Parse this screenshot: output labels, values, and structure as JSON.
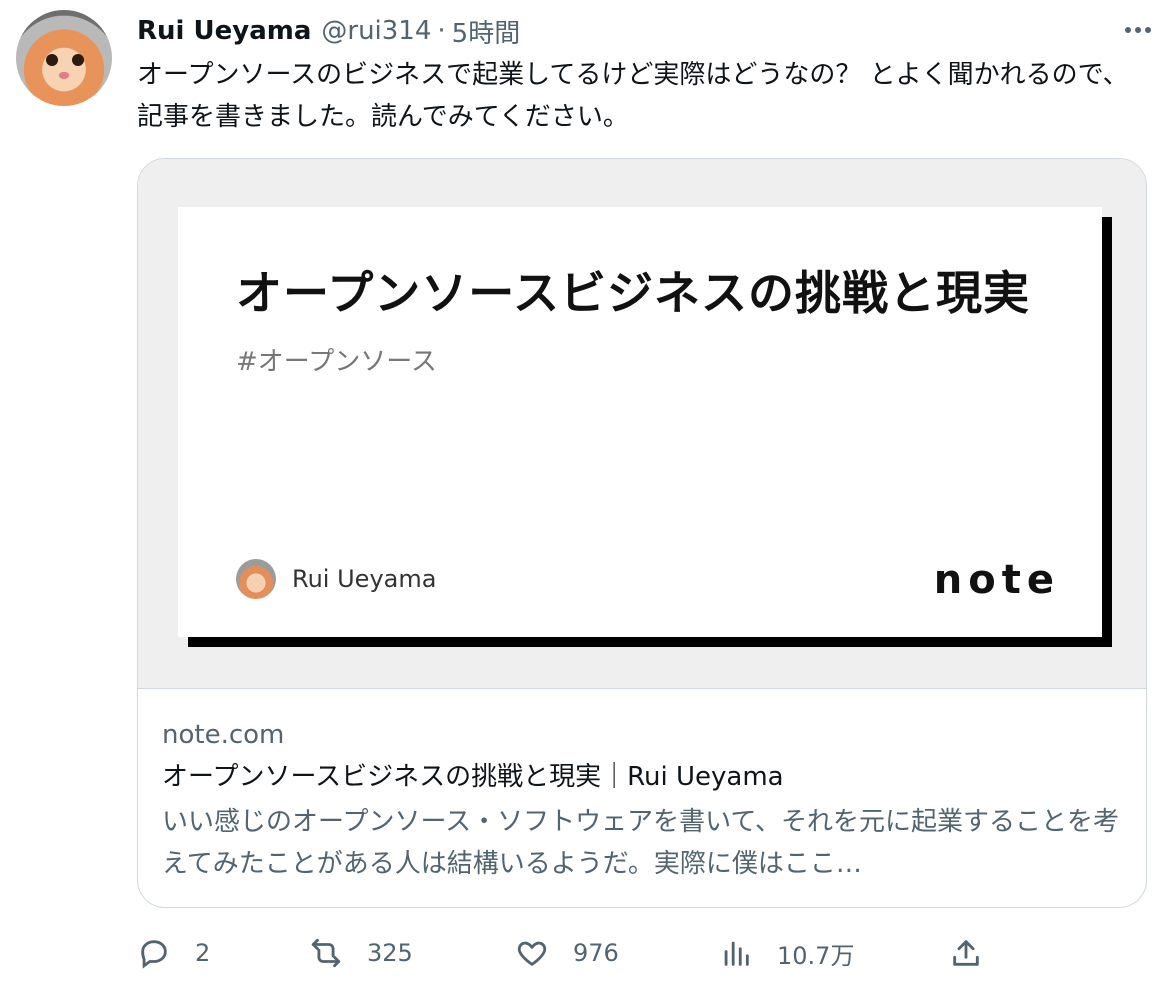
{
  "author": {
    "name": "Rui Ueyama",
    "handle": "@rui314",
    "separator": "·",
    "time": "5時間"
  },
  "tweet": {
    "text": "オープンソースのビジネスで起業してるけど実際はどうなの？ とよく聞かれるので、記事を書きました。読んでみてください。"
  },
  "card": {
    "image": {
      "title": "オープンソースビジネスの挑戦と現実",
      "tag": "#オープンソース",
      "author": "Rui Ueyama",
      "logo": "note"
    },
    "domain": "note.com",
    "title": "オープンソースビジネスの挑戦と現実｜Rui Ueyama",
    "description": "いい感じのオープンソース・ソフトウェアを書いて、それを元に起業することを考えてみたことがある人は結構いるようだ。実際に僕はここ…"
  },
  "actions": {
    "replies": "2",
    "retweets": "325",
    "likes": "976",
    "views": "10.7万"
  },
  "icons": [
    "more-icon",
    "reply-icon",
    "retweet-icon",
    "like-icon",
    "views-icon",
    "share-icon"
  ],
  "colors": {
    "text": "#0f1419",
    "secondary": "#536471",
    "border": "#cfd9de"
  }
}
